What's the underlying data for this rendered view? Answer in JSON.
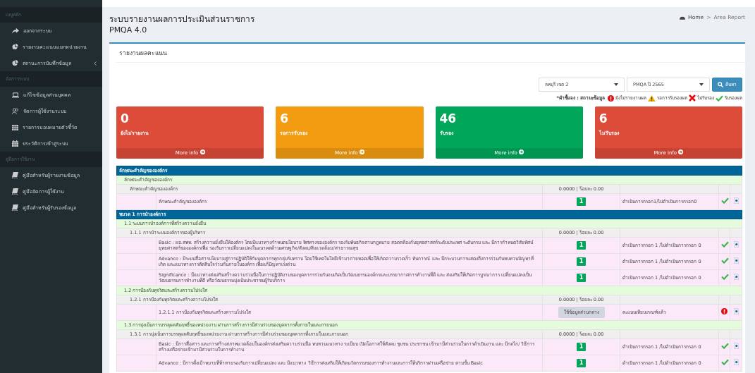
{
  "sidebar": {
    "sections": [
      {
        "header": "เมนูหลัก",
        "items": [
          {
            "label": "ออกจากระบบ",
            "expandable": false
          },
          {
            "label": "รายงานคะแนนแยกหน่วยงาน",
            "expandable": false
          },
          {
            "label": "สถานะการบันทึกข้อมูล",
            "expandable": true
          }
        ]
      },
      {
        "header": "จัดการระบบ",
        "items": [
          {
            "label": "แก้ไขข้อมูลส่วนบุคคล",
            "expandable": false
          },
          {
            "label": "จัดการผู้ใช้งานระบบ",
            "expandable": false
          },
          {
            "label": "รายการมอบหมายตัวชี้วัด",
            "expandable": false
          },
          {
            "label": "ประวัติการเข้าสู่ระบบ",
            "expandable": false
          }
        ]
      },
      {
        "header": "คู่มือการใช้งาน",
        "items": [
          {
            "label": "คู่มือสำหรับผู้รายงานข้อมูล",
            "expandable": false
          },
          {
            "label": "คู่มือจัดการผู้ใช้งาน",
            "expandable": false
          },
          {
            "label": "คู่มือสำหรับผู้รับรองข้อมูล",
            "expandable": false
          }
        ]
      }
    ]
  },
  "header": {
    "title": "ระบบรายงานผลการประเมินส่วนราชการ",
    "subtitle": "PMQA 4.0",
    "breadcrumb": [
      "Home",
      ">",
      "Area Report"
    ]
  },
  "box": {
    "title": "รายงานผลคะแนน",
    "filters": [
      {
        "value": "ลพบุรี เขต 2"
      },
      {
        "value": "PMQA ปี 2565"
      }
    ],
    "search_button": "ค้นหา",
    "legend": {
      "label": "*คำชี้แจง : สถานะข้อมูล",
      "items": [
        {
          "kind": "not_reported",
          "label": "ยังไม่รายงานผล"
        },
        {
          "kind": "pending",
          "label": "รอการรับรองผล"
        },
        {
          "kind": "rejected",
          "label": "ไม่รับรอง"
        },
        {
          "kind": "approved",
          "label": "รับรองผล"
        }
      ]
    },
    "stats": [
      {
        "value": "0",
        "label": "ยังไม่รายงาน",
        "color": "#dd4b39",
        "link": "More info"
      },
      {
        "value": "6",
        "label": "รอการรับรอง",
        "color": "#f39c12",
        "link": "More info"
      },
      {
        "value": "46",
        "label": "รับรอง",
        "color": "#00a65a",
        "link": "More info"
      },
      {
        "value": "6",
        "label": "ไม่รับรอง",
        "color": "#dd4b39",
        "link": "More info"
      }
    ],
    "rows": [
      {
        "kind": "section",
        "label": "ลักษณะสำคัญขององค์กร"
      },
      {
        "kind": "group",
        "label": "ลักษณะสำคัญขององค์กร"
      },
      {
        "kind": "subgroup",
        "label": "ลักษณะสำคัญขององค์กร",
        "score": "0.0000 | ร้อยละ 0.00"
      },
      {
        "kind": "item",
        "label": "ลักษณะสำคัญขององค์กร",
        "badge": "1",
        "note": "ดำเนินการกรอก1/ไม่ดำเนินการกรอก0",
        "approved": true
      },
      {
        "kind": "section",
        "label": "หมวด 1 การนำองค์การ"
      },
      {
        "kind": "group",
        "label": "1.1 ระบบการนำองค์การที่สร้างความยั่งยืน"
      },
      {
        "kind": "subgroup",
        "label": "1.1.1 การนำระบบองค์การของผู้บริหาร",
        "score": "0.0000 | ร้อยละ 0.00"
      },
      {
        "kind": "item",
        "label": "Basic : ผอ.สพท. สร้างความยั่งยืนให้องค์กร โดยมีแนวทางกำหนดนโยบาย ทิศทางขององค์กร รองรับพันธกิจตามกฎหมาย สอดคล้องกับยุทธศาสตร์ระดับประเทศ ระดับกรม และ มีการกำหนดวิสัยทัศน์ ยุทธศาสตร์ขององค์กรเพื่อ รองรับการเปลี่ยนแปลงในอนาคตด้านเศรษฐกิจ/สังคม/สิ่งแวดล้อม/สาธารณสุข",
        "badge": "1",
        "note": "ดำเนินการกรอก 1 /ไม่ดำเนินการกรอก 0",
        "approved": true
      },
      {
        "kind": "item",
        "label": "Advance : มีระบบสื่อสารนโยบายสู่การปฏิบัติให้กับบุคลากรทุกกลุ่มรับทราบ โดยใช้เทคโนโลยีเข้ามาถ่ายทอดเพื่อให้เกิดความรวดเร็ว ทันการณ์ และ มีกระบวนการแสดงถึงการร่วมกันทบทวนปัญหาที่เกิด และแนวทางการตัดสินใจร่วมกันภายในองค์กร เพื่อแก้ปัญหาเร่งด่วน",
        "badge": "1",
        "note": "ดำเนินการกรอก 1 /ไม่ดำเนินการกรอก 0",
        "approved": true
      },
      {
        "kind": "item",
        "label": "Significance : มีแนวทางส่งเสริมสร้างความร่วมมือในการปฏิบัติงานของบุคลากรร่วมกันจนเกิดเป็นวัฒนธรรมองค์กรและบรรยากาศการทำงานที่ดี และ ส่งเสริมให้เกิดการบูรณาการ เปลี่ยนแปลงเป็นวัฒนธรรมการทำงานที่ดี หรือวัฒนธรรมมุ่งเน้นประชาชนผู้รับบริการ",
        "badge": "1",
        "note": "ดำเนินการกรอก 1 /ไม่ดำเนินการกรอก 0",
        "approved": true
      },
      {
        "kind": "group",
        "label": "1.2 การป้องกันทุจริตและสร้างความโปร่งใส"
      },
      {
        "kind": "subgroup",
        "label": "1.2.1 การป้องกันทุจริตและสร้างความโปร่งใส",
        "score": "0.0000 | ร้อยละ 0.00"
      },
      {
        "kind": "item",
        "label": "1.2.1.1 การป้องกันทุจริตและสร้างความโปร่งใส",
        "button": "ใช้ข้อมูลส่วนกลาง",
        "note": "คะแนนเทียบเกณฑ์แล้ว",
        "approved": false
      },
      {
        "kind": "group",
        "label": "1.3 การมุ่งเน้นการบรรลุผลสัมฤทธิ์ของหน่วยงาน ผ่านการสร้างการมีส่วนร่วมของบุคลากรทั้งภายในและภายนอก"
      },
      {
        "kind": "subgroup",
        "label": "1.3.1 การมุ่งเน้นการบรรลุผลสัมฤทธิ์ของหน่วยงาน ผ่านการสร้างการมีส่วนร่วมของบุคลากรทั้งภายในและภายนอก",
        "score": "0.0000 | ร้อยละ 0.00"
      },
      {
        "kind": "item",
        "label": "Basic : มีการสื่อสาร และการสร้างสภาพแวดล้อมในองค์กรส่งเสริมความร่วมมือ ทบทวนแนวทาง ระเบียบ เปิดโอกาสให้สังคม ชุมชน ประชาชน เข้ามามีส่วนร่วมในการดำเนินงาน และ มีกลไก/ วิธีการ สร้างเครือข่ายเข้ามามีส่วนร่วมในการทำงาน",
        "badge": "1",
        "note": "ดำเนินการกรอก 1 /ไม่ดำเนินการกรอก 0",
        "approved": true
      },
      {
        "kind": "item",
        "label": "Advance : มีการตั้งเป้าหมายที่ท้าทายรองรับการเปลี่ยนแปลง และ มีแนวทาง วิธีการส่งเสริมให้เกิดนวัตกรรมของการทำงานและการให้บริการผ่านเครือข่าย ตามขั้น Basic",
        "badge": "1",
        "note": "ดำเนินการกรอก 1 /ไม่ดำเนินการกรอก 0",
        "approved": true
      }
    ]
  }
}
